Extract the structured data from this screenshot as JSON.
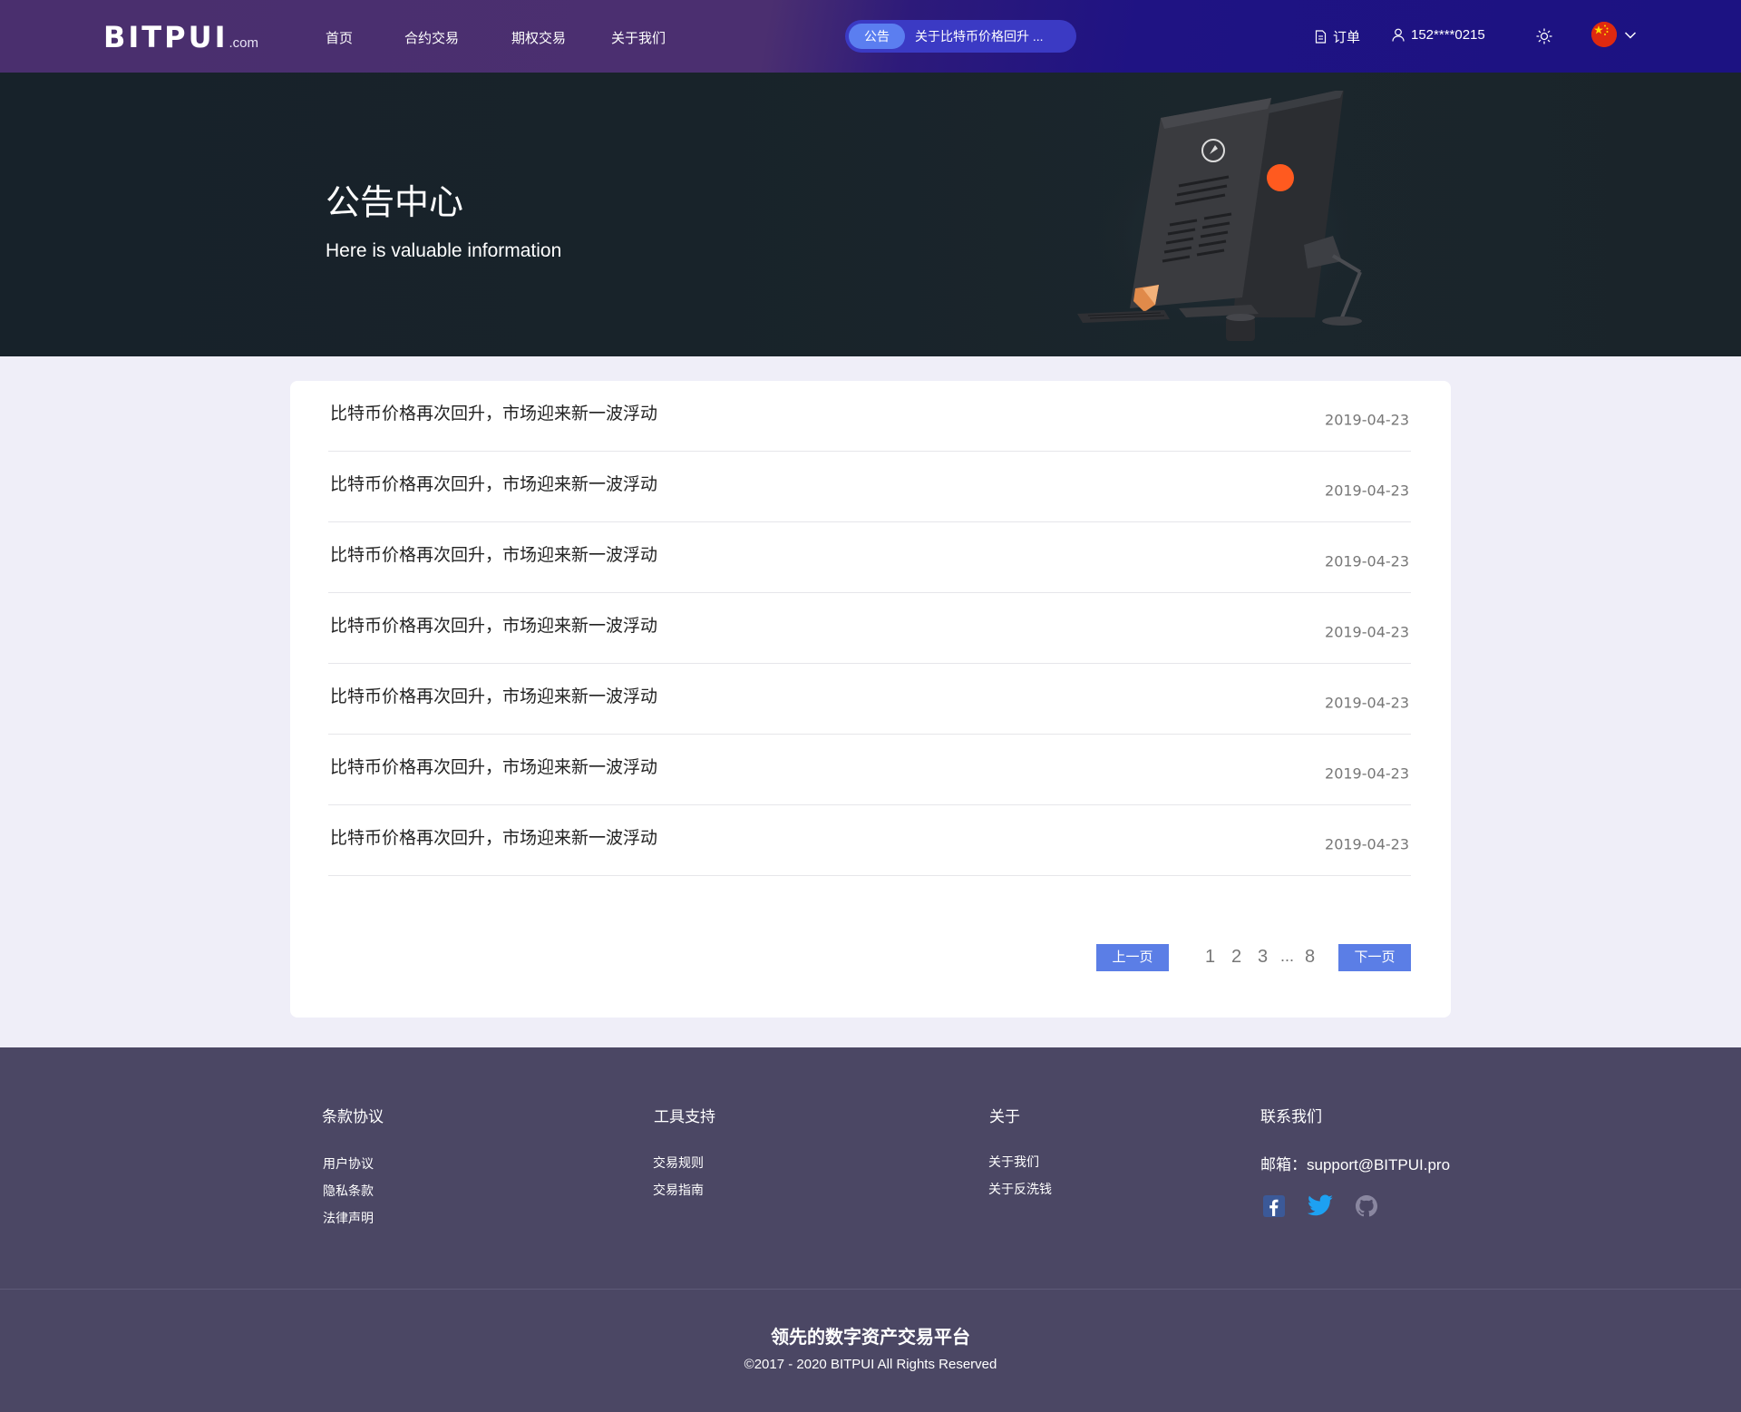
{
  "header": {
    "logo_main": "BITPUI",
    "logo_sub": ".com",
    "nav": [
      "首页",
      "合约交易",
      "期权交易",
      "关于我们"
    ],
    "notice_badge": "公告",
    "notice_text": "关于比特币价格回升 ...",
    "orders_label": "订单",
    "user_phone": "152****0215"
  },
  "hero": {
    "title": "公告中心",
    "subtitle": "Here is valuable information"
  },
  "announcements": [
    {
      "title": "比特币价格再次回升，市场迎来新一波浮动",
      "date": "2019-04-23"
    },
    {
      "title": "比特币价格再次回升，市场迎来新一波浮动",
      "date": "2019-04-23"
    },
    {
      "title": "比特币价格再次回升，市场迎来新一波浮动",
      "date": "2019-04-23"
    },
    {
      "title": "比特币价格再次回升，市场迎来新一波浮动",
      "date": "2019-04-23"
    },
    {
      "title": "比特币价格再次回升，市场迎来新一波浮动",
      "date": "2019-04-23"
    },
    {
      "title": "比特币价格再次回升，市场迎来新一波浮动",
      "date": "2019-04-23"
    },
    {
      "title": "比特币价格再次回升，市场迎来新一波浮动",
      "date": "2019-04-23"
    }
  ],
  "pagination": {
    "prev_label": "上一页",
    "next_label": "下一页",
    "pages": [
      "1",
      "2",
      "3",
      "...",
      "8"
    ]
  },
  "footer": {
    "columns": [
      {
        "title": "条款协议",
        "links": [
          "用户协议",
          "隐私条款",
          "法律声明"
        ]
      },
      {
        "title": "工具支持",
        "links": [
          "交易规则",
          "交易指南"
        ]
      },
      {
        "title": "关于",
        "links": [
          "关于我们",
          "关于反洗钱"
        ]
      },
      {
        "title": "联系我们",
        "links": []
      }
    ],
    "email": "邮箱：support@BITPUI.pro",
    "slogan": "领先的数字资产交易平台",
    "copyright": "©2017 - 2020 BITPUI All Rights Reserved"
  },
  "colors": {
    "header_bg": "#4a2f6e",
    "header_bg_end": "#1c1282",
    "accent": "#5b7ee6",
    "hero_bg": "#18232a",
    "footer_bg": "#4b4764",
    "page_bg": "#efeef8"
  },
  "icons": [
    "orders-icon",
    "user-icon",
    "sun-icon",
    "china-flag-icon",
    "chevron-down-icon",
    "facebook-icon",
    "twitter-icon",
    "github-icon"
  ]
}
